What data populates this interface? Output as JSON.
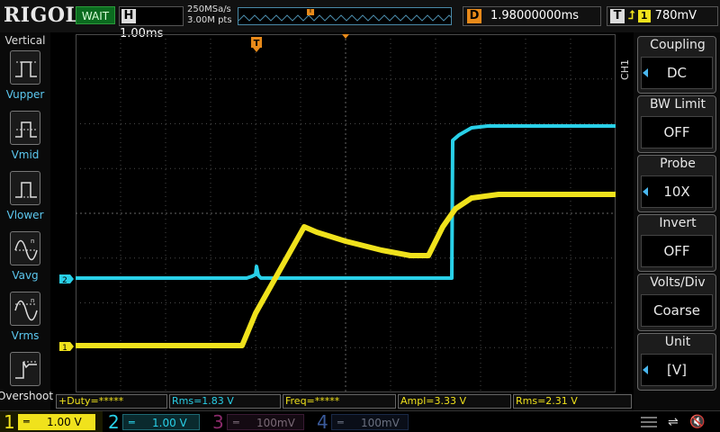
{
  "top": {
    "brand": "RIGOL",
    "run_status": "WAIT",
    "horizontal_key": "H",
    "timebase": "1.00ms",
    "sample_rate": "250MSa/s",
    "memory_depth": "3.00M pts",
    "trigger_marker": "T",
    "delay_key": "D",
    "delay_value": "1.98000000ms",
    "trigger_key": "T",
    "trigger_source": "1",
    "trigger_edge": "⮥",
    "trigger_level": "780mV"
  },
  "left_panel": {
    "title": "Vertical",
    "items": [
      {
        "label": "Vupper",
        "icon": "pulse-upper-icon"
      },
      {
        "label": "Vmid",
        "icon": "pulse-mid-icon"
      },
      {
        "label": "Vlower",
        "icon": "pulse-lower-icon"
      },
      {
        "label": "Vavg",
        "icon": "sine-avg-icon"
      },
      {
        "label": "Vrms",
        "icon": "sine-rms-icon"
      },
      {
        "label": "Overshoot",
        "icon": "overshoot-icon"
      }
    ]
  },
  "right_panel": {
    "channel_tag": "CH1",
    "items": [
      {
        "title": "Coupling",
        "value": "DC"
      },
      {
        "title": "BW Limit",
        "value": "OFF"
      },
      {
        "title": "Probe",
        "value": "10X"
      },
      {
        "title": "Invert",
        "value": "OFF"
      },
      {
        "title": "Volts/Div",
        "value": "Coarse"
      },
      {
        "title": "Unit",
        "value": "[V]"
      }
    ]
  },
  "waveform": {
    "trigger_top_marker": "T",
    "ch1_marker": "1",
    "ch2_marker": "2",
    "trigger_level_marker": "T",
    "colors": {
      "ch1": "#f0e21c",
      "ch2": "#29d0e8",
      "ch3": "#c02a8a",
      "ch4": "#3a6cd0",
      "trigger": "#e88a1a",
      "grid": "#4a4a4a"
    }
  },
  "measurements": [
    {
      "text": "+Duty=*****",
      "channel": "1"
    },
    {
      "text": "Rms=1.83 V",
      "channel": "2"
    },
    {
      "text": "Freq=*****",
      "channel": "1"
    },
    {
      "text": "Ampl=3.33 V",
      "channel": "1"
    },
    {
      "text": "Rms=2.31 V",
      "channel": "1"
    }
  ],
  "channels": [
    {
      "num": "1",
      "scale": "1.00 V",
      "active": true
    },
    {
      "num": "2",
      "scale": "1.00 V",
      "active": false
    },
    {
      "num": "3",
      "scale": "100mV",
      "active": false
    },
    {
      "num": "4",
      "scale": "100mV",
      "active": false
    }
  ],
  "status_icons": {
    "usb": "usb-icon",
    "sound": "speaker-muted-icon"
  }
}
